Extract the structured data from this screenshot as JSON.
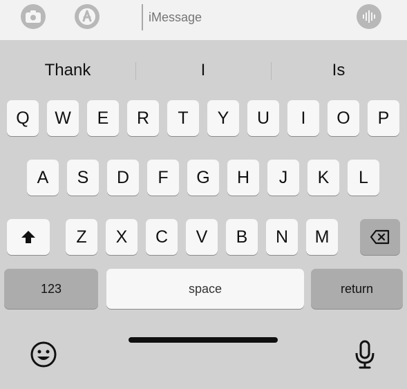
{
  "message_bar": {
    "placeholder": "iMessage",
    "camera_icon": "camera-icon",
    "appstore_icon": "appstore-icon",
    "voice_icon": "audio-waveform-icon"
  },
  "suggestions": [
    "Thank",
    "I",
    "Is"
  ],
  "rows": {
    "row1": [
      "Q",
      "W",
      "E",
      "R",
      "T",
      "Y",
      "U",
      "I",
      "O",
      "P"
    ],
    "row2": [
      "A",
      "S",
      "D",
      "F",
      "G",
      "H",
      "J",
      "K",
      "L"
    ],
    "row3": [
      "Z",
      "X",
      "C",
      "V",
      "B",
      "N",
      "M"
    ]
  },
  "keys": {
    "shift_icon": "shift-icon",
    "delete_icon": "delete-icon",
    "numbers_label": "123",
    "space_label": "space",
    "return_label": "return"
  },
  "bottom": {
    "emoji_icon": "emoji-icon",
    "mic_icon": "microphone-icon"
  }
}
